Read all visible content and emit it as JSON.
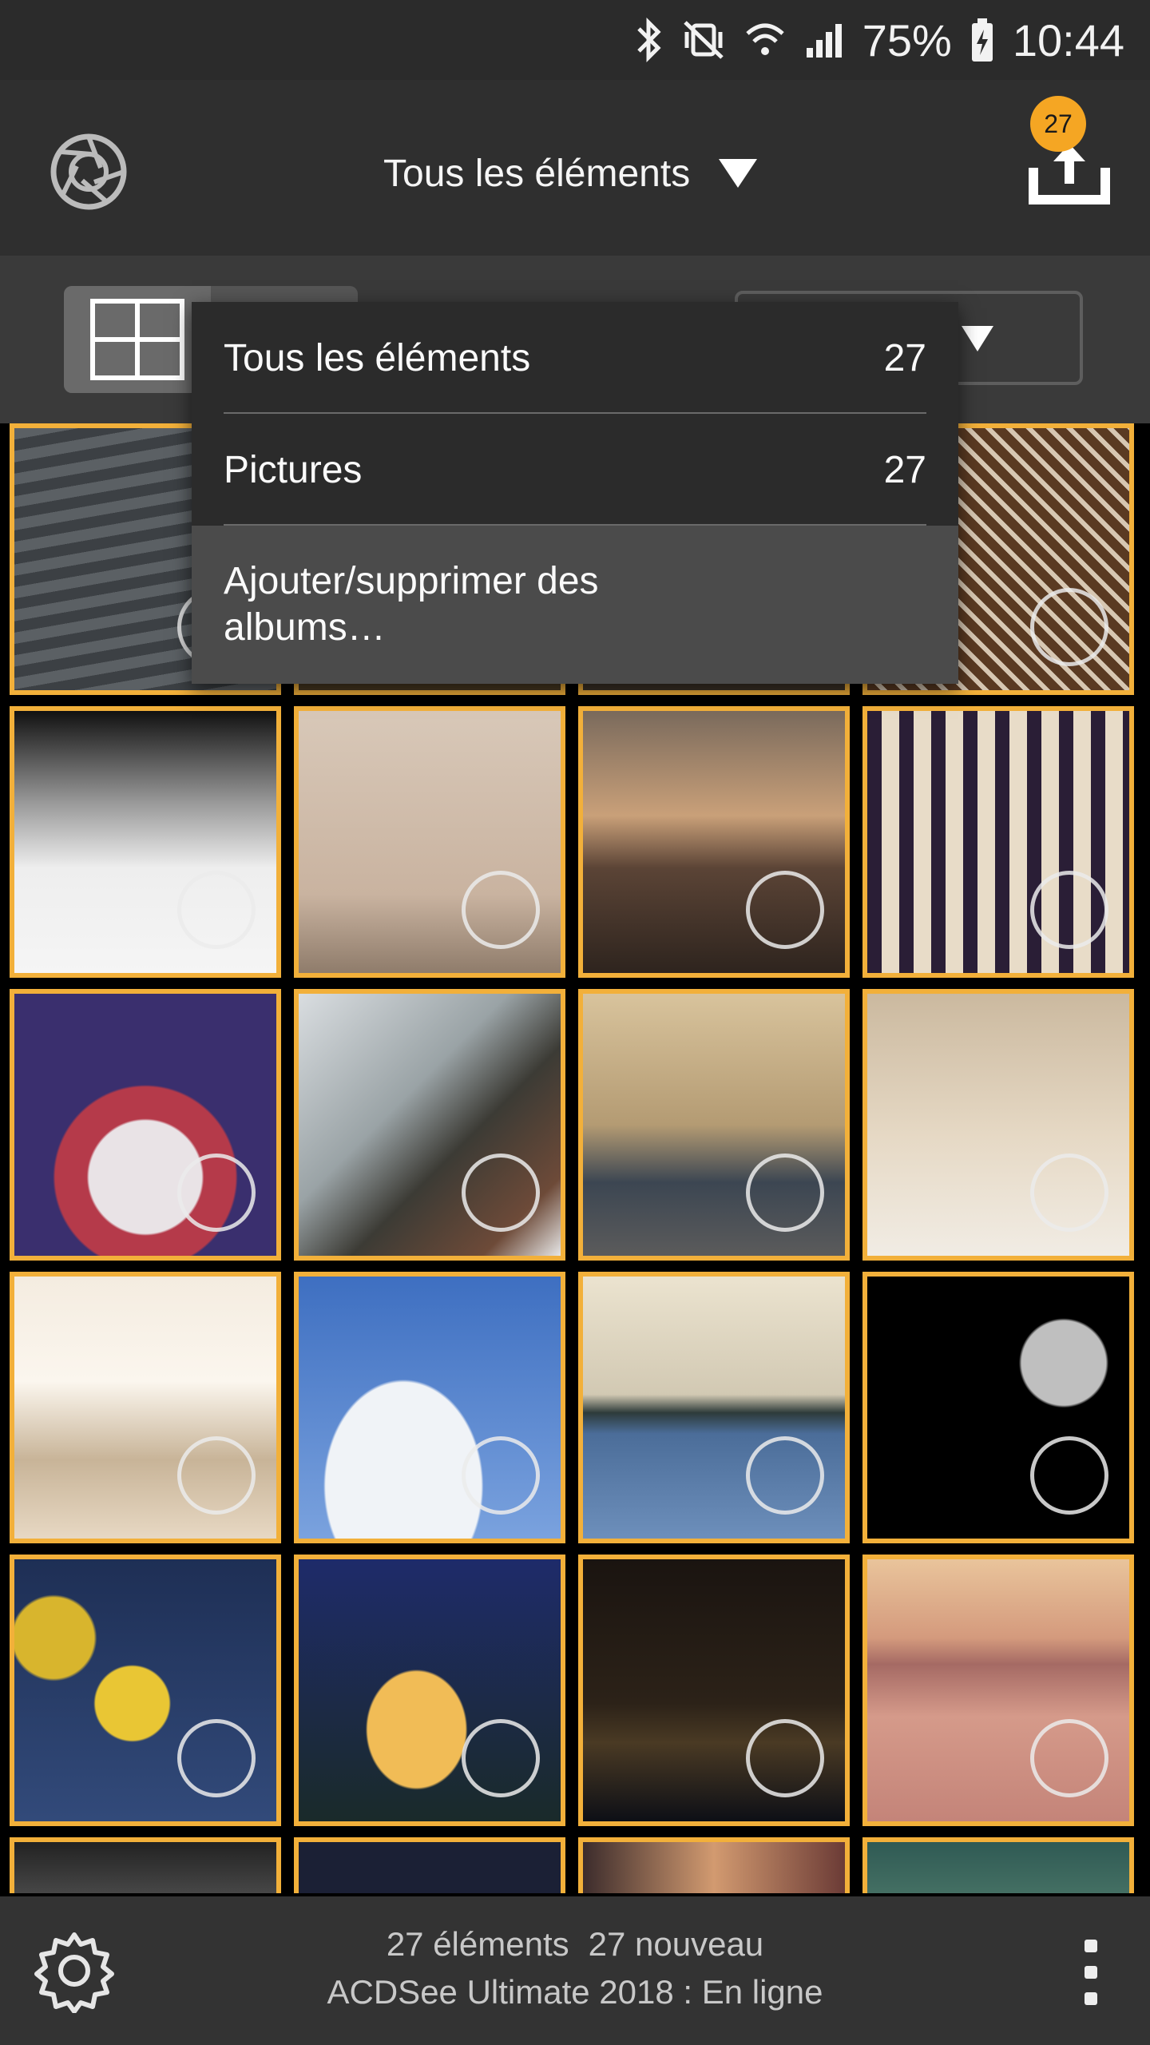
{
  "status_bar": {
    "battery": "75%",
    "time": "10:44"
  },
  "header": {
    "title": "Tous les éléments",
    "upload_count": "27"
  },
  "dropdown": {
    "items": [
      {
        "label": "Tous les éléments",
        "count": "27"
      },
      {
        "label": "Pictures",
        "count": "27"
      },
      {
        "label": "Ajouter/supprimer des albums…"
      }
    ]
  },
  "grid": {
    "thumbnails": [
      "ocean-waves",
      "hidden",
      "hidden",
      "chocolate-cake",
      "snow-footprints",
      "woman-on-beach",
      "mountain-sunset",
      "building-windows",
      "totem-face",
      "snowy-cabin",
      "vintage-cars-street",
      "marble-interior",
      "bright-hallway",
      "bird-in-sky",
      "island-lake",
      "moon-night",
      "yellow-tulips",
      "single-tulip",
      "night-city-harbor",
      "pink-sunset-boat",
      "partial-1",
      "partial-2",
      "partial-3",
      "partial-4"
    ]
  },
  "footer": {
    "line1_count": "27 éléments",
    "line1_new": "27 nouveau",
    "line2": "ACDSee Ultimate 2018 : En ligne"
  },
  "colors": {
    "accent": "#f2b03a",
    "badge": "#f5a623"
  }
}
